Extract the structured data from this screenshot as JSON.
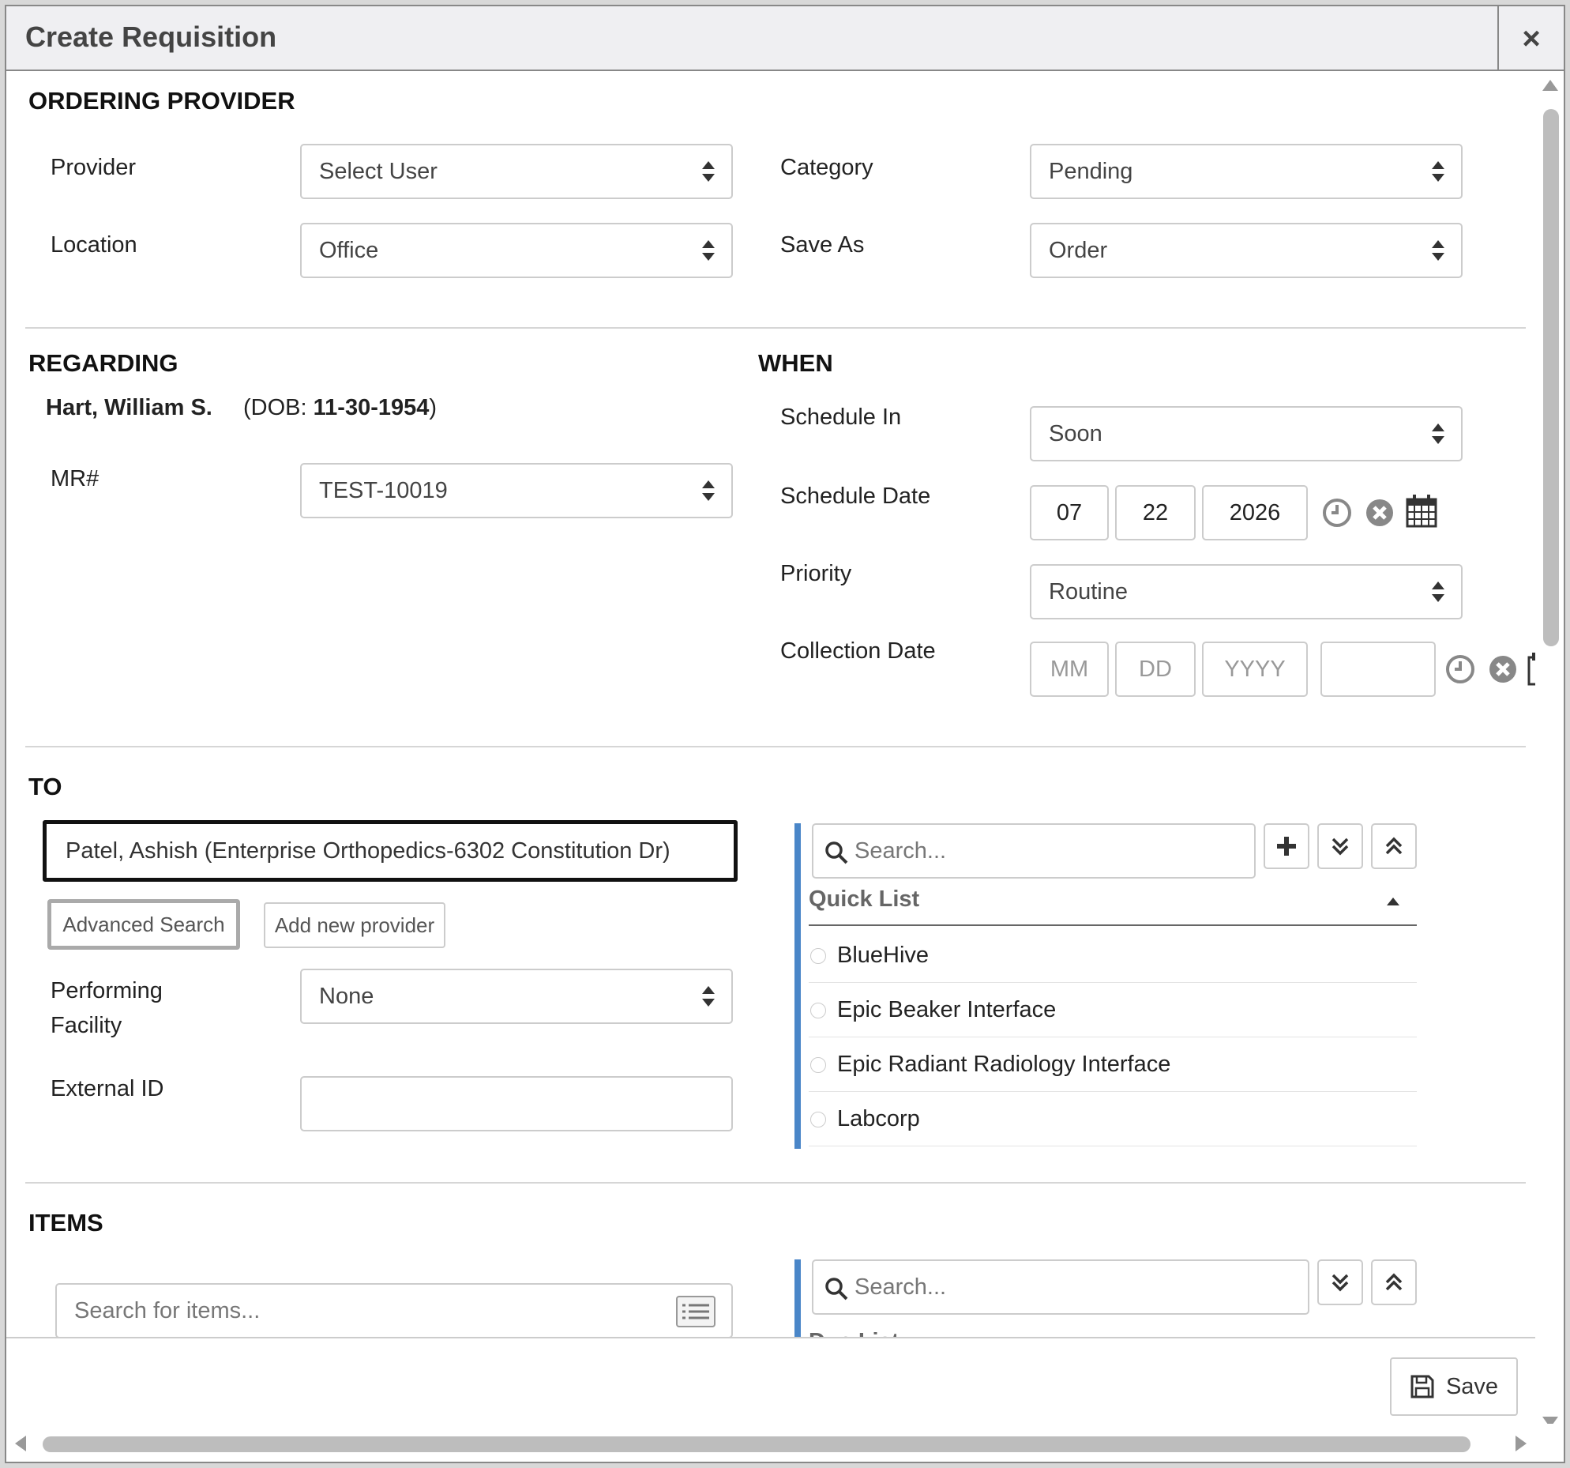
{
  "dialog": {
    "title": "Create Requisition",
    "close": "×"
  },
  "ordering_provider": {
    "heading": "ORDERING PROVIDER",
    "provider_label": "Provider",
    "provider_value": "Select User",
    "location_label": "Location",
    "location_value": "Office",
    "category_label": "Category",
    "category_value": "Pending",
    "save_as_label": "Save As",
    "save_as_value": "Order"
  },
  "regarding": {
    "heading": "REGARDING",
    "patient_name": "Hart, William S.",
    "dob_prefix": "(DOB: ",
    "dob_value": "11-30-1954",
    "dob_suffix": ")",
    "mr_label": "MR#",
    "mr_value": "TEST-10019"
  },
  "when": {
    "heading": "WHEN",
    "schedule_in_label": "Schedule In",
    "schedule_in_value": "Soon",
    "schedule_date_label": "Schedule Date",
    "schedule_month": "07",
    "schedule_day": "22",
    "schedule_year": "2026",
    "priority_label": "Priority",
    "priority_value": "Routine",
    "collection_date_label": "Collection Date",
    "collection_month_ph": "MM",
    "collection_day_ph": "DD",
    "collection_year_ph": "YYYY"
  },
  "to": {
    "heading": "TO",
    "provider_value": "Patel, Ashish (Enterprise Orthopedics-6302 Constitution Dr)",
    "advanced_search": "Advanced Search",
    "add_new_provider": "Add new provider",
    "performing_facility_label_1": "Performing",
    "performing_facility_label_2": "Facility",
    "performing_facility_value": "None",
    "external_id_label": "External ID",
    "external_id_value": "",
    "search_placeholder": "Search...",
    "quick_list_title": "Quick List",
    "quick_list": [
      {
        "label": "BlueHive"
      },
      {
        "label": "Epic Beaker Interface"
      },
      {
        "label": "Epic Radiant Radiology Interface"
      },
      {
        "label": "Labcorp"
      }
    ]
  },
  "items": {
    "heading": "ITEMS",
    "search_placeholder": "Search for items...",
    "right_search_placeholder": "Search...",
    "due_list_title": "Due List"
  },
  "footer": {
    "save_label": "Save"
  },
  "colors": {
    "accent_bar": "#4a86c8",
    "focus_border": "#111111"
  }
}
